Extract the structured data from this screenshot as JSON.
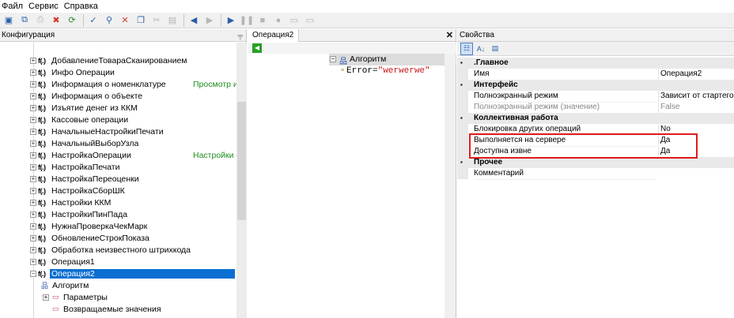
{
  "menu": {
    "items": [
      {
        "label": "Файл"
      },
      {
        "label": "Сервис"
      },
      {
        "label": "Справка"
      }
    ]
  },
  "toolbar": {
    "buttons": [
      {
        "icon": "save-icon"
      },
      {
        "icon": "save-all-icon"
      },
      {
        "icon": "print-icon"
      },
      {
        "icon": "delete-icon"
      },
      {
        "icon": "refresh-icon"
      },
      {
        "icon": "spellcheck-icon"
      },
      {
        "icon": "find-icon"
      },
      {
        "icon": "close-icon"
      },
      {
        "icon": "copy-icon"
      },
      {
        "icon": "cut-icon"
      },
      {
        "icon": "paste-icon"
      },
      {
        "icon": "back-icon"
      },
      {
        "icon": "forward-icon"
      },
      {
        "icon": "run-icon"
      },
      {
        "icon": "pause-icon"
      },
      {
        "icon": "stop-icon"
      },
      {
        "icon": "breakpoint-icon"
      },
      {
        "icon": "step-icon"
      }
    ]
  },
  "left_panel": {
    "title": "Конфигурация",
    "items": [
      {
        "label": "ДобавлениеТовараСканированием",
        "note": ""
      },
      {
        "label": "Инфо Операции",
        "note": ""
      },
      {
        "label": "Информация о номенклатуре",
        "note": "Просмотр ин"
      },
      {
        "label": "Информация о объекте",
        "note": ""
      },
      {
        "label": "Изъятие денег из ККМ",
        "note": ""
      },
      {
        "label": "Кассовые операции",
        "note": ""
      },
      {
        "label": "НачальныеНастройкиПечати",
        "note": ""
      },
      {
        "label": "НачальныйВыборУзла",
        "note": ""
      },
      {
        "label": "НастройкаОперации",
        "note": "Настройки о"
      },
      {
        "label": "НастройкаПечати",
        "note": ""
      },
      {
        "label": "НастройкаПереоценки",
        "note": ""
      },
      {
        "label": "НастройкаСборШК",
        "note": ""
      },
      {
        "label": "Настройки ККМ",
        "note": ""
      },
      {
        "label": "НастройкиПинПада",
        "note": ""
      },
      {
        "label": "НужнаПроверкаЧекМарк",
        "note": ""
      },
      {
        "label": "ОбновлениеСтрокПоказа",
        "note": ""
      },
      {
        "label": "Обработка неизвестного штрихкода",
        "note": ""
      },
      {
        "label": "Операция1",
        "note": ""
      },
      {
        "label": "Операция2",
        "note": "",
        "selected": true
      }
    ],
    "children": [
      {
        "label": "Алгоритм",
        "icon": "algorithm-icon"
      },
      {
        "label": "Параметры",
        "icon": "parameters-icon"
      },
      {
        "label": "Возвращаемые значения",
        "icon": "return-values-icon"
      }
    ],
    "func_icon_text": "f(.)"
  },
  "editor": {
    "tab": "Операция2",
    "node_label": "Алгоритм",
    "code_prefix": "Error=",
    "code_string": "\"werwerwe\""
  },
  "properties": {
    "title": "Свойства",
    "rows": [
      {
        "type": "cat",
        "name": ".Главное"
      },
      {
        "type": "prop",
        "name": "Имя",
        "value": "Операция2"
      },
      {
        "type": "cat",
        "name": "Интерфейс"
      },
      {
        "type": "prop",
        "name": "Полноэкранный режим",
        "value": "Зависит от стартего"
      },
      {
        "type": "prop",
        "name": "Полноэкранный режим (значение)",
        "value": "False",
        "grey": true
      },
      {
        "type": "cat",
        "name": "Коллективная работа"
      },
      {
        "type": "prop",
        "name": "Блокировка других операций",
        "value": "No"
      },
      {
        "type": "prop",
        "name": "Выполняется на сервере",
        "value": "Да"
      },
      {
        "type": "prop",
        "name": "Доступна извне",
        "value": "Да"
      },
      {
        "type": "cat",
        "name": "Прочее"
      },
      {
        "type": "prop",
        "name": "Комментарий",
        "value": ""
      }
    ]
  },
  "colors": {
    "selection": "#0a6fd1",
    "note_green": "#1d8f1d",
    "highlight_box": "#e01b1b",
    "string_red": "#c8171e"
  }
}
